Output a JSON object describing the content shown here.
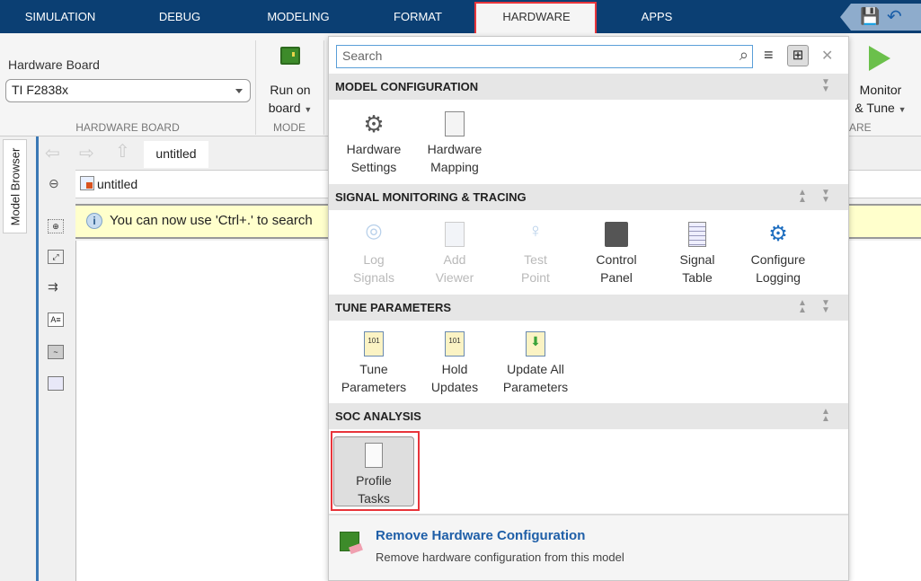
{
  "tabs": [
    "SIMULATION",
    "DEBUG",
    "MODELING",
    "FORMAT",
    "HARDWARE",
    "APPS"
  ],
  "active_tab": "HARDWARE",
  "ribbon": {
    "hardware_board_label": "Hardware Board",
    "hardware_board_value": "TI F2838x",
    "hardware_board_section": "HARDWARE BOARD",
    "run_on_board": [
      "Run on",
      "board"
    ],
    "mode_section": "MODE",
    "monitor_tune": [
      "Monitor",
      "& Tune"
    ],
    "partial_section": "ARE"
  },
  "editor": {
    "model_browser": "Model Browser",
    "doc_tab": "untitled",
    "address": "untitled",
    "info": "You can now use 'Ctrl+.' to search"
  },
  "gallery": {
    "search_placeholder": "Search",
    "sections": [
      {
        "title": "MODEL CONFIGURATION",
        "items": [
          [
            "Hardware",
            "Settings"
          ],
          [
            "Hardware",
            "Mapping"
          ]
        ]
      },
      {
        "title": "SIGNAL MONITORING & TRACING",
        "items": [
          [
            "Log",
            "Signals"
          ],
          [
            "Add",
            "Viewer"
          ],
          [
            "Test",
            "Point"
          ],
          [
            "Control",
            "Panel"
          ],
          [
            "Signal",
            "Table"
          ],
          [
            "Configure",
            "Logging"
          ]
        ]
      },
      {
        "title": "TUNE PARAMETERS",
        "items": [
          [
            "Tune",
            "Parameters"
          ],
          [
            "Hold",
            "Updates"
          ],
          [
            "Update All",
            "Parameters"
          ]
        ]
      },
      {
        "title": "SOC ANALYSIS",
        "items": [
          [
            "Profile",
            "Tasks"
          ]
        ]
      }
    ],
    "footer_title": "Remove Hardware Configuration",
    "footer_desc": "Remove hardware configuration from this model"
  },
  "colors": {
    "tabbar": "#0b3f73",
    "highlight": "#e8353b",
    "link": "#1f5fa8",
    "info_bg": "#ffffcc"
  }
}
